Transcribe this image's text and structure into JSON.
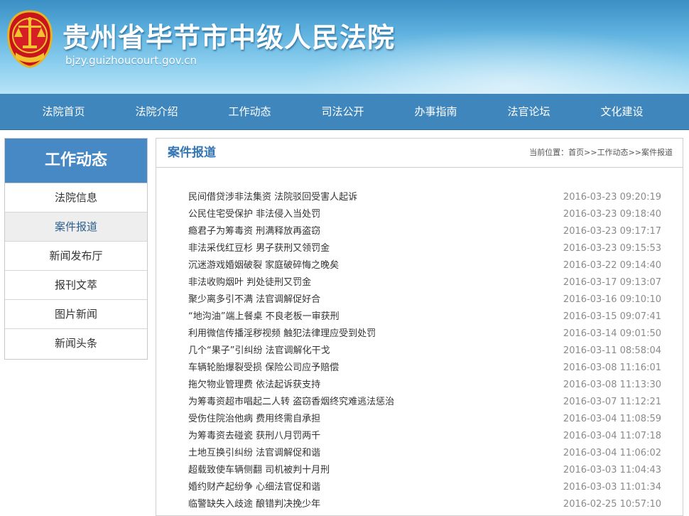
{
  "header": {
    "title": "贵州省毕节市中级人民法院",
    "url": "bjzy.guizhoucourt.gov.cn"
  },
  "nav": [
    "法院首页",
    "法院介绍",
    "工作动态",
    "司法公开",
    "办事指南",
    "法官论坛",
    "文化建设"
  ],
  "sidebar": {
    "title": "工作动态",
    "items": [
      "法院信息",
      "案件报道",
      "新闻发布厅",
      "报刊文萃",
      "图片新闻",
      "新闻头条"
    ],
    "active_index": 1
  },
  "main": {
    "title": "案件报道",
    "breadcrumb": {
      "prefix": "当前位置：",
      "items": [
        "首页",
        "工作动态",
        "案件报道"
      ],
      "sep": ">>"
    },
    "news": [
      {
        "title": "民间借贷涉非法集资 法院驳回受害人起诉",
        "date": "2016-03-23 09:20:19"
      },
      {
        "title": "公民住宅受保护 非法侵入当处罚",
        "date": "2016-03-23 09:18:40"
      },
      {
        "title": "瘾君子为筹毒资 刑满释放再盗窃",
        "date": "2016-03-23 09:17:17"
      },
      {
        "title": "非法采伐红豆杉 男子获刑又领罚金",
        "date": "2016-03-23 09:15:53"
      },
      {
        "title": "沉迷游戏婚姻破裂 家庭破碎悔之晚矣",
        "date": "2016-03-22 09:14:40"
      },
      {
        "title": "非法收购烟叶 判处徒刑又罚金",
        "date": "2016-03-17 09:13:07"
      },
      {
        "title": "聚少离多引不满 法官调解促好合",
        "date": "2016-03-16 09:10:10"
      },
      {
        "title": "“地沟油”端上餐桌 不良老板一审获刑",
        "date": "2016-03-15 09:07:41"
      },
      {
        "title": "利用微信传播淫秽视频 触犯法律理应受到处罚",
        "date": "2016-03-14 09:01:50"
      },
      {
        "title": "几个“果子”引纠纷 法官调解化干戈",
        "date": "2016-03-11 08:58:04"
      },
      {
        "title": "车辆轮胎爆裂受损 保险公司应予赔偿",
        "date": "2016-03-08 11:16:01"
      },
      {
        "title": "拖欠物业管理费 依法起诉获支持",
        "date": "2016-03-08 11:13:30"
      },
      {
        "title": "为筹毒资超市唱起二人转 盗窃香烟终究难逃法惩治",
        "date": "2016-03-07 11:12:21"
      },
      {
        "title": "受伤住院治他病 费用终需自承担",
        "date": "2016-03-04 11:08:59"
      },
      {
        "title": "为筹毒资去碰瓷 获刑八月罚两千",
        "date": "2016-03-04 11:07:18"
      },
      {
        "title": "土地互换引纠纷 法官调解促和谐",
        "date": "2016-03-04 11:06:02"
      },
      {
        "title": "超载致使车辆侧翻 司机被判十月刑",
        "date": "2016-03-03 11:04:43"
      },
      {
        "title": "婚约财产起纷争 心细法官促和谐",
        "date": "2016-03-03 11:01:34"
      },
      {
        "title": "临警缺失入歧途 酿错判决挽少年",
        "date": "2016-02-25 10:57:10"
      }
    ]
  }
}
